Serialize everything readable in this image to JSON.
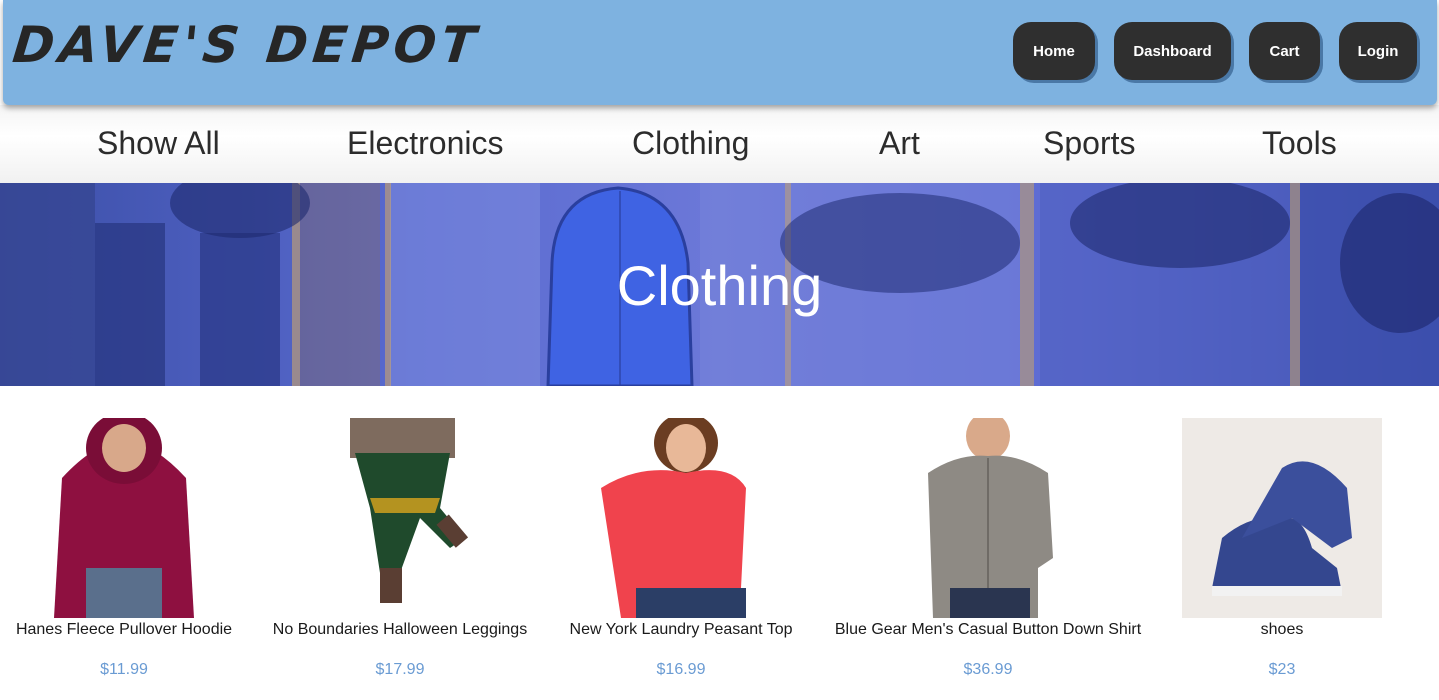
{
  "header": {
    "logo": "DAVE'S DEPOT",
    "nav": [
      "Home",
      "Dashboard",
      "Cart",
      "Login"
    ]
  },
  "categories": [
    "Show All",
    "Electronics",
    "Clothing",
    "Art",
    "Sports",
    "Tools"
  ],
  "hero": {
    "title": "Clothing"
  },
  "products": [
    {
      "name": "Hanes Fleece Pullover Hoodie",
      "price": "$11.99"
    },
    {
      "name": "No Boundaries Halloween Leggings",
      "price": "$17.99"
    },
    {
      "name": "New York Laundry Peasant Top",
      "price": "$16.99"
    },
    {
      "name": "Blue Gear Men's Casual Button Down Shirt",
      "price": "$36.99"
    },
    {
      "name": "shoes",
      "price": "$23"
    }
  ],
  "colors": {
    "header_bg": "#7eb2e0",
    "button_bg": "#2f2f2f",
    "price": "#6a9bd3",
    "hero_tint": "#5a6bd0"
  }
}
